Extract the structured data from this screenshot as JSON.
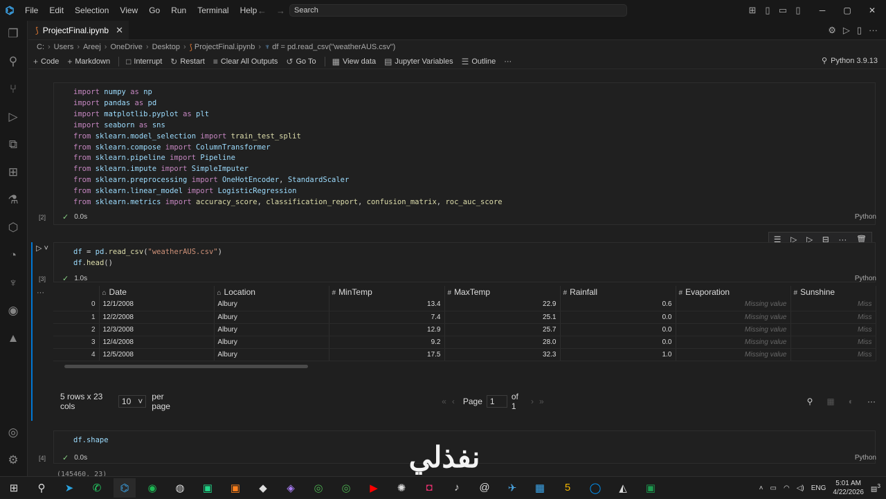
{
  "titlebar": {
    "menus": [
      "File",
      "Edit",
      "Selection",
      "View",
      "Go",
      "Run",
      "Terminal",
      "Help"
    ],
    "search_placeholder": "Search"
  },
  "tab": {
    "label": "ProjectFinal.ipynb"
  },
  "breadcrumb": [
    "C:",
    "Users",
    "Areej",
    "OneDrive",
    "Desktop",
    "ProjectFinal.ipynb",
    "df = pd.read_csv(\"weatherAUS.csv\")"
  ],
  "toolbar": {
    "code": "Code",
    "markdown": "Markdown",
    "interrupt": "Interrupt",
    "restart": "Restart",
    "clear_all_outputs": "Clear All Outputs",
    "go_to": "Go To",
    "view_data": "View data",
    "jupyter_variables": "Jupyter Variables",
    "outline": "Outline",
    "more": "···",
    "kernel": "Python 3.9.13"
  },
  "cells": [
    {
      "exec": "[2]",
      "time": "0.0s",
      "lang": "Python"
    },
    {
      "exec": "[3]",
      "time": "1.0s",
      "lang": "Python"
    },
    {
      "exec": "[4]",
      "time": "0.0s",
      "lang": "Python",
      "code": "df.shape",
      "output": "(145460, 23)"
    }
  ],
  "cell1_lines": [
    "import numpy as np",
    "import pandas as pd",
    "import matplotlib.pyplot as plt",
    "import seaborn as sns",
    "from sklearn.model_selection import train_test_split",
    "from sklearn.compose import ColumnTransformer",
    "from sklearn.pipeline import Pipeline",
    "from sklearn.impute import SimpleImputer",
    "from sklearn.preprocessing import OneHotEncoder, StandardScaler",
    "from sklearn.linear_model import LogisticRegression",
    "from sklearn.metrics import accuracy_score, classification_report, confusion_matrix, roc_auc_score"
  ],
  "cell2_lines": [
    "df = pd.read_csv(\"weatherAUS.csv\")",
    "df.head()"
  ],
  "grid": {
    "columns": [
      "Date",
      "Location",
      "MinTemp",
      "MaxTemp",
      "Rainfall",
      "Evaporation",
      "Sunshine"
    ],
    "rows": [
      {
        "idx": "0",
        "date": "12/1/2008",
        "loc": "Albury",
        "min": "13.4",
        "max": "22.9",
        "rain": "0.6",
        "evap": "Missing value",
        "sun": "Miss"
      },
      {
        "idx": "1",
        "date": "12/2/2008",
        "loc": "Albury",
        "min": "7.4",
        "max": "25.1",
        "rain": "0.0",
        "evap": "Missing value",
        "sun": "Miss"
      },
      {
        "idx": "2",
        "date": "12/3/2008",
        "loc": "Albury",
        "min": "12.9",
        "max": "25.7",
        "rain": "0.0",
        "evap": "Missing value",
        "sun": "Miss"
      },
      {
        "idx": "3",
        "date": "12/4/2008",
        "loc": "Albury",
        "min": "9.2",
        "max": "28.0",
        "rain": "0.0",
        "evap": "Missing value",
        "sun": "Miss"
      },
      {
        "idx": "4",
        "date": "12/5/2008",
        "loc": "Albury",
        "min": "17.5",
        "max": "32.3",
        "rain": "1.0",
        "evap": "Missing value",
        "sun": "Miss"
      }
    ],
    "summary": "5 rows x 23 cols",
    "page_size": "10",
    "per_page": "per page",
    "page_label": "Page",
    "page_value": "1",
    "of_label": "of 1"
  },
  "watermark": "نفذلي",
  "taskbar": {
    "lang": "ENG",
    "time": "5:01 AM",
    "date": "4/22/2026",
    "notif": "3"
  },
  "colors": {
    "accent": "#0078d4",
    "success": "#89d185",
    "keyword": "#c586c0",
    "variable": "#9cdcfe"
  }
}
